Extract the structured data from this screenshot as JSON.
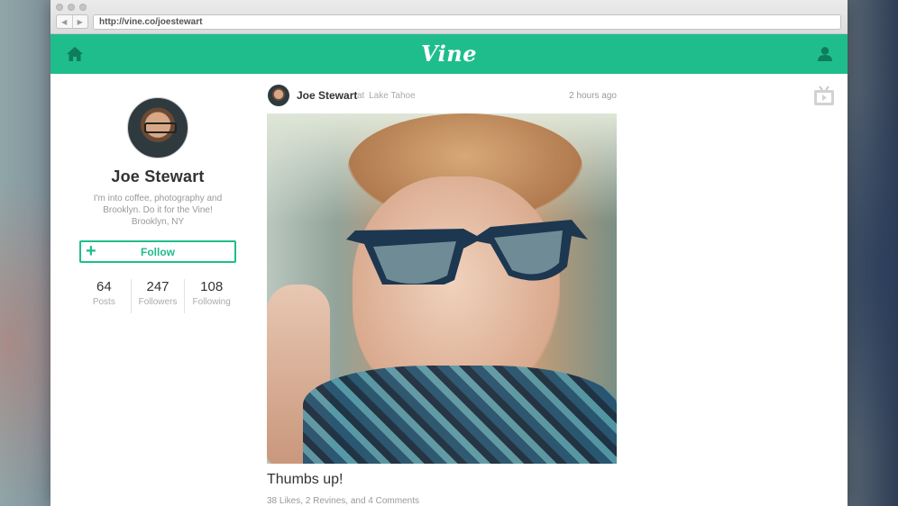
{
  "browser": {
    "url": "http://vine.co/joestewart",
    "back_glyph": "◀",
    "forward_glyph": "▶"
  },
  "header": {
    "logo_text": "Vine",
    "accent_color": "#1fbd8b"
  },
  "profile": {
    "name": "Joe Stewart",
    "bio_line1": "I'm into coffee, photography and",
    "bio_line2": "Brooklyn. Do it for the Vine!",
    "bio_line3": "Brooklyn, NY",
    "follow_label": "Follow",
    "follow_glyph": "+",
    "stats": [
      {
        "value": "64",
        "label": "Posts"
      },
      {
        "value": "247",
        "label": "Followers"
      },
      {
        "value": "108",
        "label": "Following"
      }
    ]
  },
  "post": {
    "author": "Joe Stewart",
    "location_prefix": "at",
    "location": "Lake Tahoe",
    "time": "2 hours ago",
    "caption": "Thumbs up!",
    "engagement": "38 Likes, 2 Revines, and 4 Comments"
  },
  "icons": {
    "home": "home-icon",
    "user": "user-icon",
    "tv": "tv-icon"
  }
}
